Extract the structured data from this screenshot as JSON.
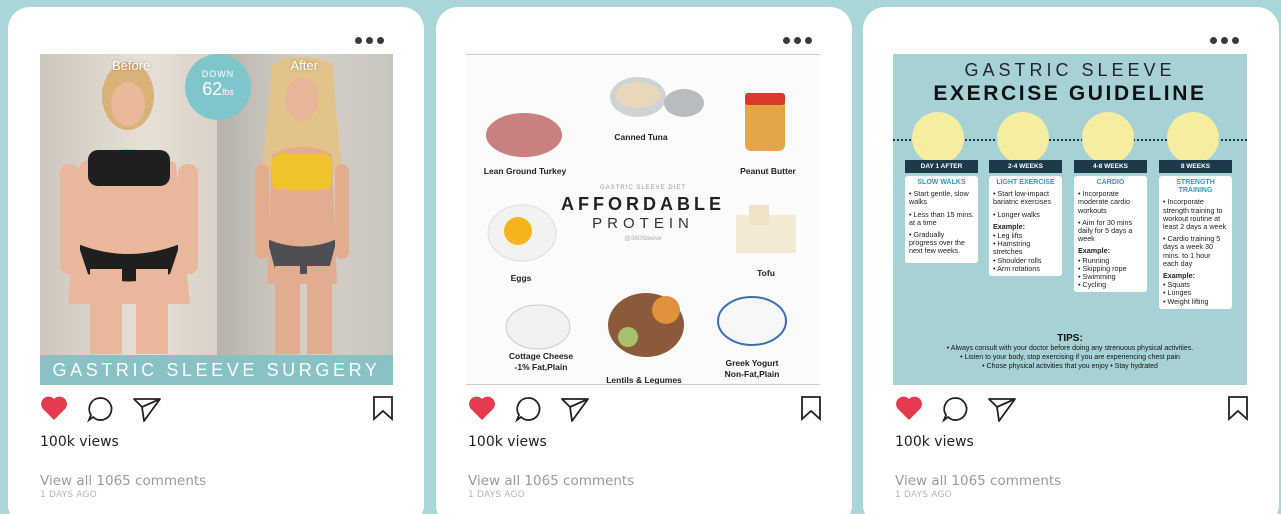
{
  "colors": {
    "background": "#a9d6d8",
    "like": "#e63b4f",
    "accent": "#89c1c4"
  },
  "icons": {
    "more": "more-dots-icon",
    "like": "heart-icon",
    "comment": "comment-icon",
    "share": "send-icon",
    "save": "bookmark-icon"
  },
  "posts": [
    {
      "views": "100k views",
      "comments": "View all 1065 comments",
      "ago": "1 DAYS AGO",
      "image": {
        "before": "Before",
        "after": "After",
        "badge_top": "DOWN",
        "badge_value": "62",
        "badge_unit": "lbs",
        "band": "GASTRIC SLEEVE SURGERY"
      }
    },
    {
      "views": "100k views",
      "comments": "View all 1065 comments",
      "ago": "1 DAYS AGO",
      "image": {
        "small": "GASTRIC SLEEVE DIET",
        "title1": "AFFORDABLE",
        "title2": "PROTEIN",
        "handle": "@360Sleeve",
        "foods": [
          "Lean Ground Turkey",
          "Canned Tuna",
          "Peanut Butter",
          "Eggs",
          "Tofu",
          "Cottage Cheese",
          "-1% Fat,Plain",
          "Lentils & Legumes",
          "Greek Yogurt",
          "Non-Fat,Plain"
        ]
      }
    },
    {
      "views": "100k views",
      "comments": "View all 1065 comments",
      "ago": "1 DAYS AGO",
      "image": {
        "title1": "GASTRIC SLEEVE",
        "title2": "EXERCISE GUIDELINE",
        "phases": [
          {
            "label": "DAY 1 AFTER SURGERY",
            "head": "SLOW WALKS",
            "items": [
              "• Start gentle, slow walks",
              "• Less than 15 mins. at a time",
              "• Gradually progress over the next few weeks."
            ]
          },
          {
            "label": "2-4 WEEKS",
            "head": "LIGHT EXERCISE",
            "items": [
              "• Start low-impact bariatric exercises",
              "• Longer walks"
            ],
            "example": "Example:",
            "ex_items": [
              "• Leg lifts",
              "• Hamstring stretches",
              "• Shoulder rolls",
              "• Arm rotations"
            ]
          },
          {
            "label": "4-8 WEEKS",
            "head": "CARDIO",
            "items": [
              "• Incorporate moderate cardio workouts",
              "• Aim for 30 mins daily for 5 days a week"
            ],
            "example": "Example:",
            "ex_items": [
              "• Running",
              "• Skipping rope",
              "• Swimming",
              "• Cycling"
            ]
          },
          {
            "label": "8 WEEKS",
            "head": "STRENGTH TRAINING",
            "items": [
              "• Incorporate strength training to workout routine at least 2 days a week",
              "• Cardio training 5 days a week 30 mins. to 1 hour each day"
            ],
            "example": "Example:",
            "ex_items": [
              "• Squats",
              "• Lunges",
              "• Weight lifting"
            ]
          }
        ],
        "tips_head": "TIPS:",
        "tips": [
          "• Always consult with your doctor before doing any strenuous physical activities.",
          "• Listen to your body, stop exercising if you are experiencing chest pain",
          "• Chose physical activities that you enjoy • Stay hydrated"
        ]
      }
    }
  ]
}
